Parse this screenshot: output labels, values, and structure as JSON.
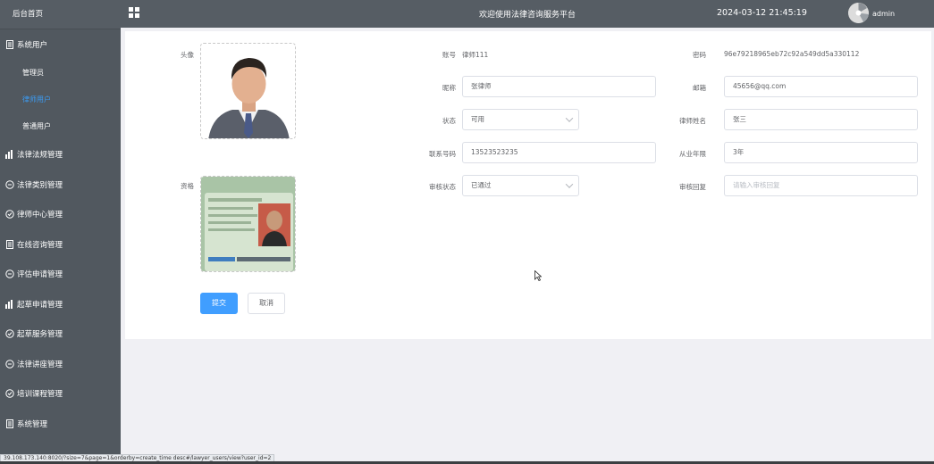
{
  "sidebar": {
    "home": "后台首页",
    "items": [
      {
        "label": "系统用户",
        "icon": "document-icon",
        "children": [
          "管理员",
          "律师用户",
          "普通用户"
        ],
        "active_child": "律师用户"
      },
      {
        "label": "法律法规管理",
        "icon": "bar-chart-icon"
      },
      {
        "label": "法律类别管理",
        "icon": "chat-bubble-icon"
      },
      {
        "label": "律师中心管理",
        "icon": "check-circle-icon"
      },
      {
        "label": "在线咨询管理",
        "icon": "document-icon"
      },
      {
        "label": "评估申请管理",
        "icon": "chat-bubble-icon"
      },
      {
        "label": "起草申请管理",
        "icon": "bar-chart-icon"
      },
      {
        "label": "起草服务管理",
        "icon": "check-circle-icon"
      },
      {
        "label": "法律讲座管理",
        "icon": "chat-bubble-icon"
      },
      {
        "label": "培训课程管理",
        "icon": "check-circle-icon"
      },
      {
        "label": "系统管理",
        "icon": "document-icon"
      }
    ]
  },
  "header": {
    "title": "欢迎使用法律咨询服务平台",
    "datetime": "2024-03-12 21:45:19",
    "username": "admin"
  },
  "form": {
    "avatar_label": "头像",
    "certificate_label": "资格",
    "account_label": "账号",
    "account": "律师111",
    "password_label": "密码",
    "password": "96e79218965eb72c92a549dd5a330112",
    "nickname_label": "昵称",
    "nickname": "张律师",
    "email_label": "邮箱",
    "email": "45656@qq.com",
    "status_label": "状态",
    "status": "可用",
    "lawyer_name_label": "律师姓名",
    "lawyer_name": "张三",
    "phone_label": "联系号码",
    "phone": "13523523235",
    "years_label": "从业年限",
    "years": "3年",
    "review_status_label": "审核状态",
    "review_status": "已通过",
    "review_reply_label": "审核回复",
    "review_reply_placeholder": "请输入审核回复",
    "submit_label": "提交",
    "cancel_label": "取消"
  },
  "status_url": "39.108.173.140:8020/?size=7&page=1&orderby=create_time desc#/lawyer_users/view?user_id=2",
  "colors": {
    "sidebar_bg": "#51585f",
    "header_bg": "#565d64",
    "active_link": "#3b9cf5",
    "primary_button": "#409eff"
  }
}
